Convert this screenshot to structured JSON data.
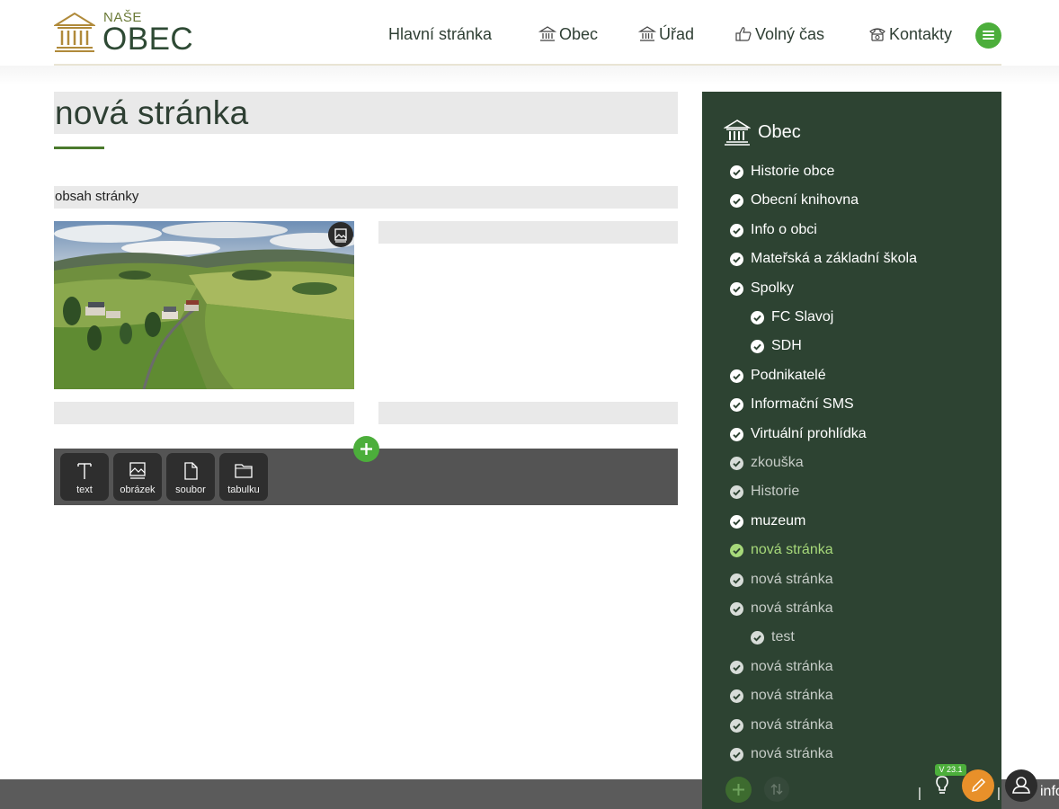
{
  "header": {
    "logo_small": "NAŠE",
    "logo_big": "OBEC",
    "nav": [
      {
        "label": "Hlavní stránka",
        "icon": "none"
      },
      {
        "label": "Obec",
        "icon": "building-icon"
      },
      {
        "label": "Úřad",
        "icon": "building-icon"
      },
      {
        "label": "Volný čas",
        "icon": "thumbs-up-icon"
      },
      {
        "label": "Kontakty",
        "icon": "phone-icon"
      }
    ]
  },
  "main": {
    "page_title": "nová stránka",
    "content_label": "obsah stránky"
  },
  "toolbar": {
    "text_label": "text",
    "image_label": "obrázek",
    "file_label": "soubor",
    "table_label": "tabulku"
  },
  "sidebar": {
    "heading": "Obec",
    "items": [
      {
        "label": "Historie obce",
        "level": 0,
        "state": "normal"
      },
      {
        "label": "Obecní knihovna",
        "level": 0,
        "state": "normal"
      },
      {
        "label": "Info o obci",
        "level": 0,
        "state": "normal"
      },
      {
        "label": "Mateřská a základní škola",
        "level": 0,
        "state": "normal"
      },
      {
        "label": "Spolky",
        "level": 0,
        "state": "normal"
      },
      {
        "label": "FC Slavoj",
        "level": 1,
        "state": "normal"
      },
      {
        "label": "SDH",
        "level": 1,
        "state": "normal"
      },
      {
        "label": "Podnikatelé",
        "level": 0,
        "state": "normal"
      },
      {
        "label": "Informační SMS",
        "level": 0,
        "state": "normal"
      },
      {
        "label": "Virtuální prohlídka",
        "level": 0,
        "state": "normal"
      },
      {
        "label": "zkouška",
        "level": 0,
        "state": "dim"
      },
      {
        "label": "Historie",
        "level": 0,
        "state": "dim"
      },
      {
        "label": "muzeum",
        "level": 0,
        "state": "normal"
      },
      {
        "label": "nová stránka",
        "level": 0,
        "state": "active"
      },
      {
        "label": "nová stránka",
        "level": 0,
        "state": "dim"
      },
      {
        "label": "nová stránka",
        "level": 0,
        "state": "dim"
      },
      {
        "label": "test",
        "level": 1,
        "state": "dim"
      },
      {
        "label": "nová stránka",
        "level": 0,
        "state": "dim"
      },
      {
        "label": "nová stránka",
        "level": 0,
        "state": "dim"
      },
      {
        "label": "nová stránka",
        "level": 0,
        "state": "dim"
      },
      {
        "label": "nová stránka",
        "level": 0,
        "state": "dim"
      }
    ]
  },
  "bottom_bar": {
    "version": "V 23.1",
    "user_label": "info"
  },
  "colors": {
    "accent_green": "#4cae3b",
    "sidebar_bg": "#2d4332",
    "active_item": "#a7d97a",
    "edit_orange": "#e8902a"
  }
}
